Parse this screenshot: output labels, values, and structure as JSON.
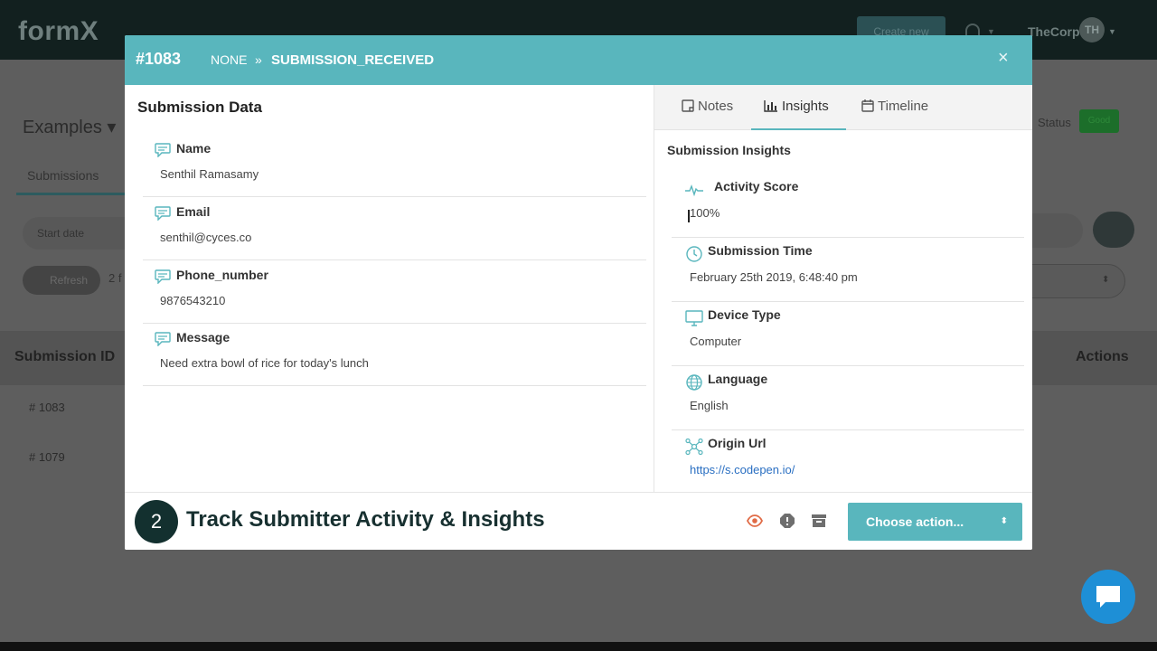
{
  "app": {
    "logo": "formX",
    "create_label": "Create new",
    "user_name": "TheCorp",
    "user_initials": "TH"
  },
  "background": {
    "examples_label": "Examples",
    "submissions_tab": "Submissions",
    "start_date_placeholder": "Start date",
    "refresh_label": "Refresh",
    "count_text": "2 f",
    "status_label": "Status",
    "status_badge": "Good",
    "col_submission_id": "Submission ID",
    "col_actions": "Actions",
    "rows": [
      "# 1083",
      "# 1079"
    ]
  },
  "modal": {
    "id": "#1083",
    "from_status": "NONE",
    "separator": "»",
    "to_status": "SUBMISSION_RECEIVED",
    "close_glyph": "×",
    "left_title": "Submission Data",
    "fields": [
      {
        "label": "Name",
        "value": "Senthil Ramasamy"
      },
      {
        "label": "Email",
        "value": "senthil@cyces.co"
      },
      {
        "label": "Phone_number",
        "value": "9876543210"
      },
      {
        "label": "Message",
        "value": "Need extra bowl of rice for today's lunch"
      }
    ],
    "tabs": [
      {
        "label": "Notes",
        "icon": "note-icon"
      },
      {
        "label": "Insights",
        "icon": "bar-chart-icon"
      },
      {
        "label": "Timeline",
        "icon": "calendar-icon"
      }
    ],
    "active_tab": "Insights",
    "insights_title": "Submission Insights",
    "insights": [
      {
        "label": "Activity Score",
        "value": "100%",
        "icon": "pulse-icon"
      },
      {
        "label": "Submission Time",
        "value": "February 25th 2019, 6:48:40 pm",
        "icon": "clock-icon"
      },
      {
        "label": "Device Type",
        "value": "Computer",
        "icon": "monitor-icon"
      },
      {
        "label": "Language",
        "value": "English",
        "icon": "globe-icon"
      },
      {
        "label": "Origin Url",
        "value": "https://s.codepen.io/",
        "icon": "network-icon"
      }
    ],
    "step_number": "2",
    "step_text": "Track Submitter Activity & Insights",
    "choose_action_label": "Choose action...",
    "choose_caret": "⬍"
  },
  "colors": {
    "accent": "#59b6bd",
    "dark": "#13302f",
    "link": "#2a6fc2",
    "eye_icon": "#e06a45",
    "chat": "#1e8fd6"
  }
}
